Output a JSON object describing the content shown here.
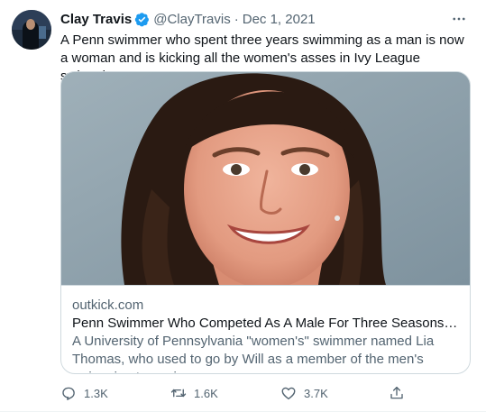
{
  "author": {
    "name": "Clay Travis",
    "handle": "@ClayTravis",
    "separator": "·",
    "date": "Dec 1, 2021"
  },
  "tweet_text": "A Penn swimmer who spent three years swimming as a man is now a woman and is kicking all the women's asses in Ivy League swimming.",
  "link_card": {
    "domain": "outkick.com",
    "title": "Penn Swimmer Who Competed As A Male For Three Seasons Now Do...",
    "description": "A University of Pennsylvania \"women's\" swimmer named Lia Thomas, who used to go by Will as a member of the men's swimming team, is ..."
  },
  "actions": {
    "replies": "1.3K",
    "retweets": "1.6K",
    "likes": "3.7K"
  },
  "icons": [
    "verified-badge-icon",
    "more-options-icon",
    "reply-icon",
    "retweet-icon",
    "like-icon",
    "share-icon"
  ],
  "colors": {
    "verified": "#1d9bf0",
    "text": "#0f1419",
    "secondary": "#536471",
    "border": "#cfd9de"
  }
}
